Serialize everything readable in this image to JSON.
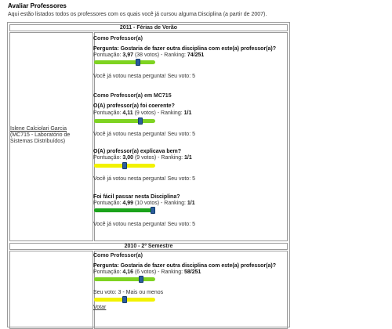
{
  "page": {
    "title": "Avaliar Professores",
    "intro": "Aqui estão listados todos os professores com os quais você já cursou alguma Disciplina (a partir de 2007)."
  },
  "sections": [
    {
      "header": "2011 - Férias de Verão",
      "teacher": {
        "name": "Islene Calciolari Garcia",
        "detail": "(MC715 - Laboratório de Sistemas Distribuídos)"
      },
      "groups": [
        {
          "title": "Como Professor(a)",
          "questions": [
            {
              "text": "Pergunta: Gostaria de fazer outra disciplina com este(a) professor(a)?",
              "score_label": "Pontuação: ",
              "score": "3,97",
              "votes": "(38 votos)",
              "ranking_label": " - Ranking: ",
              "ranking": "74/251",
              "status": "Você já votou nesta pergunta! Seu voto: 5",
              "level_pct": 74,
              "color": "#7ed321"
            }
          ]
        },
        {
          "title": "Como Professor(a) em MC715",
          "questions": [
            {
              "text": "O(A) professor(a) foi coerente?",
              "score_label": "Pontuação: ",
              "score": "4,11",
              "votes": "(9 votos)",
              "ranking_label": " - Ranking: ",
              "ranking": "1/1",
              "status": "Você já votou nesta pergunta! Seu voto: 5",
              "level_pct": 78,
              "color": "#7ed321"
            },
            {
              "text": "O(A) professor(a) explicava bem?",
              "score_label": "Pontuação: ",
              "score": "3,00",
              "votes": "(9 votos)",
              "ranking_label": " - Ranking: ",
              "ranking": "1/1",
              "status": "Você já votou nesta pergunta! Seu voto: 5",
              "level_pct": 50,
              "color": "#f2f200"
            },
            {
              "text": "Foi fácil passar nesta Disciplina?",
              "score_label": "Pontuação: ",
              "score": "4,99",
              "votes": "(10 votos)",
              "ranking_label": " - Ranking: ",
              "ranking": "1/1",
              "status": "Você já votou nesta pergunta! Seu voto: 5",
              "level_pct": 100,
              "color": "#1aa31a"
            }
          ]
        }
      ]
    },
    {
      "header": "2010 - 2º Semestre",
      "groups": [
        {
          "title": "Como Professor(a)",
          "questions": [
            {
              "text": "Pergunta: Gostaria de fazer outra disciplina com este(a) professor(a)?",
              "score_label": "Pontuação: ",
              "score": "4,16",
              "votes": "(6 votos)",
              "ranking_label": " - Ranking: ",
              "ranking": "58/251",
              "level_pct": 79,
              "color": "#7ed321"
            }
          ],
          "user_vote": {
            "text": "Seu voto: 3 - Mais ou menos",
            "level_pct": 50,
            "color": "#f2f200",
            "button": "Votar"
          }
        }
      ]
    }
  ]
}
